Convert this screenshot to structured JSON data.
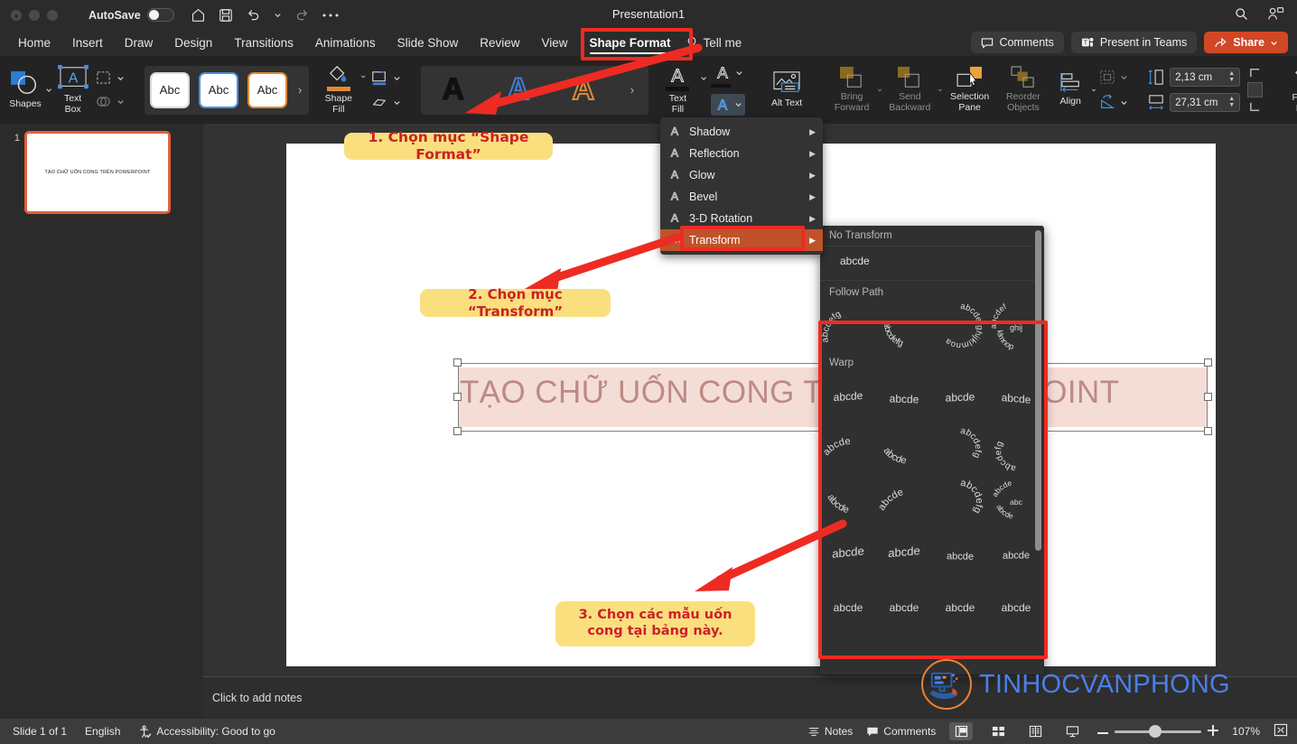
{
  "titlebar": {
    "autosave_label": "AutoSave",
    "autosave_state": "off",
    "document_title": "Presentation1",
    "quick_access": [
      "home-icon",
      "save-icon",
      "undo-icon",
      "undo-dropdown-icon",
      "redo-icon",
      "more-icon"
    ],
    "right_icons": [
      "search-icon",
      "account-icon"
    ]
  },
  "ribbon_tabs": {
    "items": [
      {
        "label": "Home",
        "active": false
      },
      {
        "label": "Insert",
        "active": false
      },
      {
        "label": "Draw",
        "active": false
      },
      {
        "label": "Design",
        "active": false
      },
      {
        "label": "Transitions",
        "active": false
      },
      {
        "label": "Animations",
        "active": false
      },
      {
        "label": "Slide Show",
        "active": false
      },
      {
        "label": "Review",
        "active": false
      },
      {
        "label": "View",
        "active": false
      },
      {
        "label": "Shape Format",
        "active": true
      }
    ],
    "tell_me": "Tell me",
    "comments_label": "Comments",
    "present_in_teams_label": "Present in Teams",
    "share_label": "Share",
    "share_color": "#d24726"
  },
  "ribbon": {
    "shapes_label": "Shapes",
    "text_box_label": "Text Box",
    "shape_styles": [
      {
        "text": "Abc",
        "variant": "plain"
      },
      {
        "text": "Abc",
        "variant": "blue"
      },
      {
        "text": "Abc",
        "variant": "orange"
      }
    ],
    "shape_fill_label": "Shape Fill",
    "wordart_styles": [
      {
        "letter": "A",
        "color": "#151515"
      },
      {
        "letter": "A",
        "color": "#3d7fd4"
      },
      {
        "letter": "A",
        "color": "#e08a35"
      }
    ],
    "text_fill_label": "Text Fill",
    "text_effects_label": "text-effects-icon",
    "alt_text_label": "Alt Text",
    "bring_forward_label": "Bring Forward",
    "send_backward_label": "Send Backward",
    "selection_pane_label": "Selection Pane",
    "reorder_objects_label": "Reorder Objects",
    "align_label": "Align",
    "height_value": "2,13 cm",
    "width_value": "27,31 cm",
    "format_pane_label": "Format Pane",
    "gallery_more": "›"
  },
  "text_effects_menu": {
    "items": [
      {
        "label": "Shadow",
        "icon": "A",
        "selected": false
      },
      {
        "label": "Reflection",
        "icon": "A",
        "selected": false
      },
      {
        "label": "Glow",
        "icon": "A",
        "selected": false
      },
      {
        "label": "Bevel",
        "icon": "A",
        "selected": false
      },
      {
        "label": "3-D Rotation",
        "icon": "A",
        "selected": false
      },
      {
        "label": "Transform",
        "icon": "abc",
        "selected": true
      }
    ],
    "selected_color": "#c0522a"
  },
  "transform_gallery": {
    "section_no_transform": "No Transform",
    "no_transform_sample": "abcde",
    "section_follow_path": "Follow Path",
    "follow_path_count": 4,
    "section_warp": "Warp",
    "warp_rows": 6,
    "warp_cols": 4,
    "sample_text": "abcde"
  },
  "slides_pane": {
    "slide_number": "1",
    "thumbnail_text": "TẠO CHỮ UỐN CONG TRÊN POWERPOINT"
  },
  "slide": {
    "title_text": "TẠO CHỮ UỐN CONG TRÊN POWERPOINT",
    "selected": true,
    "notes_placeholder": "Click to add notes"
  },
  "annotations": {
    "callouts": [
      {
        "id": 1,
        "text": "1. Chọn mục “Shape Format”"
      },
      {
        "id": 2,
        "text": "2. Chọn mục “Transform”"
      },
      {
        "id": 3,
        "text": "3. Chọn các mẫu uốn cong tại bảng này."
      }
    ],
    "highlight_color": "#ee2b23",
    "callout_bg": "#fadf7f",
    "callout_text_color": "#cc2028"
  },
  "watermark": {
    "text": "TINHOCVANPHONG",
    "text_color": "#4a7fea",
    "ring_color": "#e8833a"
  },
  "status_bar": {
    "slide_count": "Slide 1 of 1",
    "language": "English",
    "accessibility": "Accessibility: Good to go",
    "notes_label": "Notes",
    "comments_label": "Comments",
    "zoom_level": "107%",
    "views": [
      "normal-view",
      "slide-sorter-view",
      "reading-view",
      "slide-show-view"
    ]
  }
}
